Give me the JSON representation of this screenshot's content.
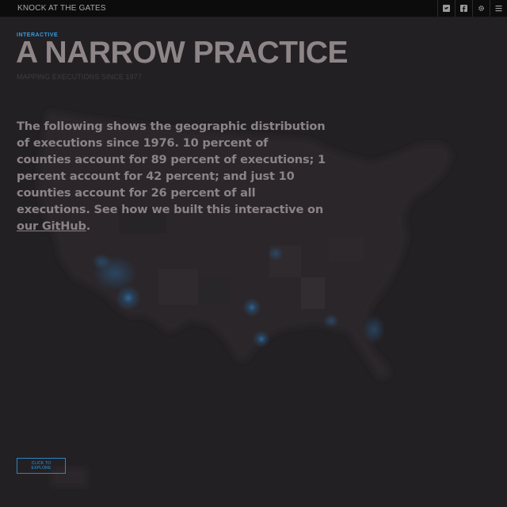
{
  "header": {
    "site_title": "KNOCK AT THE GATES",
    "icons": [
      "twitter-icon",
      "facebook-icon",
      "settings-icon",
      "menu-icon"
    ]
  },
  "article": {
    "kicker": "INTERACTIVE",
    "title": "A NARROW PRACTICE",
    "subtitle": "MAPPING EXECUTIONS SINCE 1977",
    "intro_text": "The following shows the geographic distribution of executions since 1976. 10 percent of counties account for 89 percent of executions; 1 percent account for 42 percent; and just 10 counties account for 26 percent of all executions. See how we built this interactive on ",
    "intro_link": "our GitHub",
    "intro_end": "."
  },
  "explore_button": {
    "label": "CLICK TO EXPLORE"
  },
  "colors": {
    "background": "#232023",
    "topbar": "#0c0c0c",
    "accent": "#2f9ee6",
    "headline": "#8e8587",
    "map_land": "#2a2729",
    "hotspot": "#2a6ea8"
  }
}
